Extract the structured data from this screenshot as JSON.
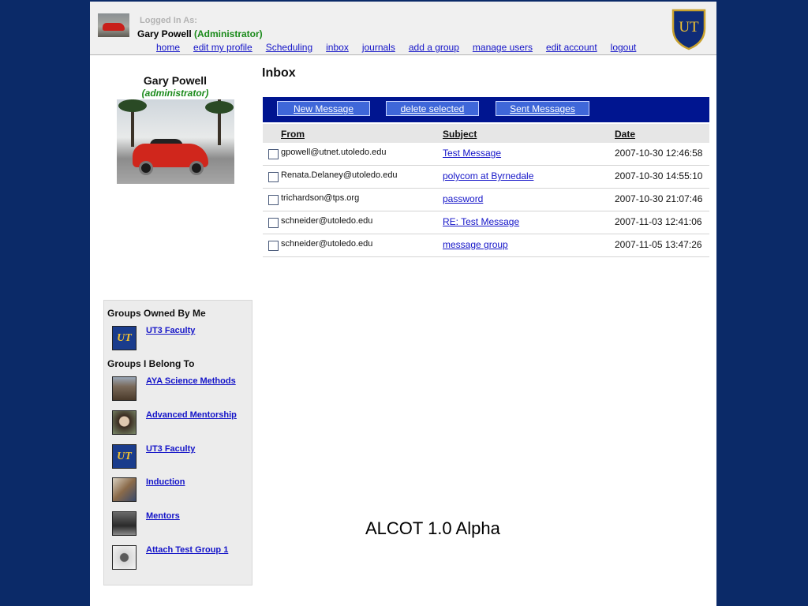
{
  "header": {
    "logged_in_label": "Logged In As:",
    "user_name": "Gary Powell",
    "user_role": "(Administrator)",
    "logo_text": "UT",
    "nav": [
      "home",
      "edit my profile",
      "Scheduling",
      "inbox",
      "journals",
      "add a group",
      "manage users",
      "edit account",
      "logout"
    ]
  },
  "profile": {
    "name": "Gary Powell",
    "role": "(administrator)"
  },
  "inbox": {
    "title": "Inbox",
    "buttons": [
      "New Message",
      "delete selected",
      "Sent Messages"
    ],
    "columns": [
      "From",
      "Subject",
      "Date"
    ],
    "messages": [
      {
        "from": "gpowell@utnet.utoledo.edu",
        "subject": "Test Message",
        "date": "2007-10-30 12:46:58"
      },
      {
        "from": "Renata.Delaney@utoledo.edu",
        "subject": "polycom at Byrnedale",
        "date": "2007-10-30 14:55:10"
      },
      {
        "from": "trichardson@tps.org",
        "subject": "password",
        "date": "2007-10-30 21:07:46"
      },
      {
        "from": "schneider@utoledo.edu",
        "subject": "RE: Test Message",
        "date": "2007-11-03 12:41:06"
      },
      {
        "from": "schneider@utoledo.edu",
        "subject": "message group",
        "date": "2007-11-05 13:47:26"
      }
    ]
  },
  "groups": {
    "owned_heading": "Groups Owned By Me",
    "owned": [
      {
        "name": "UT3 Faculty",
        "icon": "ut3-logo-icon"
      }
    ],
    "belong_heading": "Groups I Belong To",
    "belong": [
      {
        "name": "AYA Science Methods",
        "icon": "building-photo-icon"
      },
      {
        "name": "Advanced Mentorship",
        "icon": "person-photo-icon"
      },
      {
        "name": "UT3 Faculty",
        "icon": "ut3-logo-icon"
      },
      {
        "name": "Induction",
        "icon": "classroom-photo-icon"
      },
      {
        "name": "Mentors",
        "icon": "group-photo-icon"
      },
      {
        "name": "Attach Test Group 1",
        "icon": "device-photo-icon"
      }
    ],
    "badge_text": "UT"
  },
  "footer": {
    "text": "ALCOT 1.0 Alpha"
  },
  "colors": {
    "background": "#0b2a68",
    "toolbar": "#001590",
    "link": "#1414c8",
    "role_green": "#1a8a1a"
  }
}
